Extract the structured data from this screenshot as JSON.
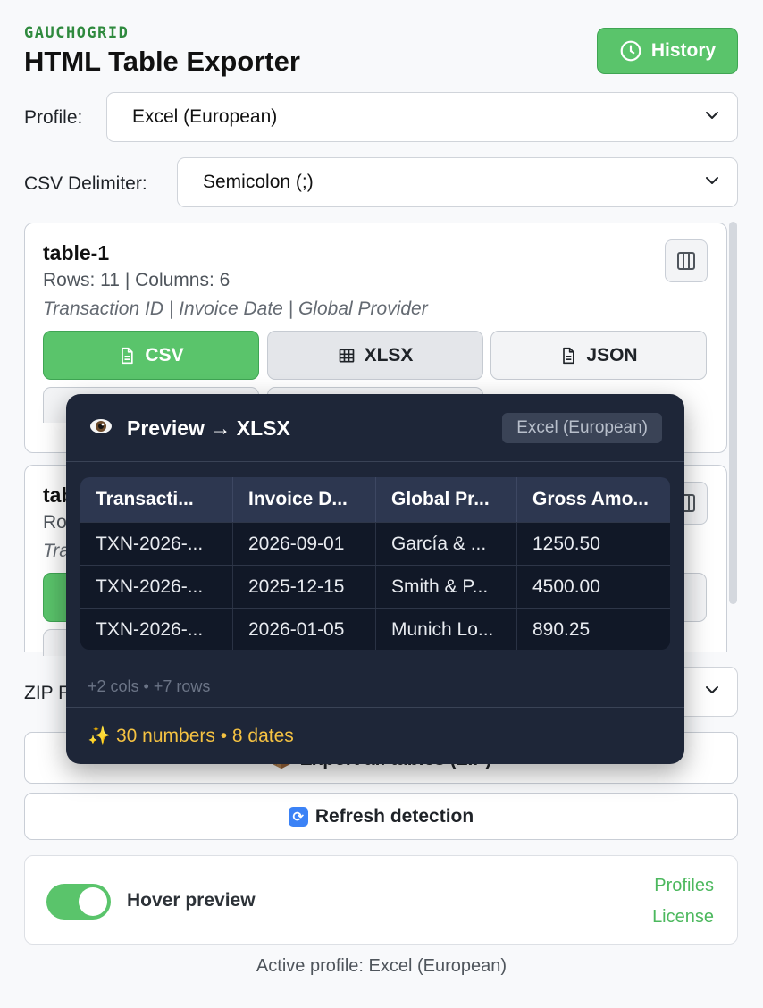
{
  "header": {
    "brand": "GAUCHOGRID",
    "title": "HTML Table Exporter",
    "history_label": "History"
  },
  "profile": {
    "label": "Profile:",
    "selected": "Excel (European)"
  },
  "csv_delimiter": {
    "label": "CSV Delimiter:",
    "selected": "Semicolon (;)"
  },
  "tables": [
    {
      "name": "table-1",
      "meta": "Rows: 11 | Columns: 6",
      "columns_preview": "Transaction ID | Invoice Date | Global Provider",
      "buttons": {
        "csv": "CSV",
        "xlsx": "XLSX",
        "json": "JSON"
      }
    },
    {
      "name": "tab",
      "meta": "Ro",
      "columns_preview": "Tra"
    }
  ],
  "zip": {
    "label": "ZIP F"
  },
  "actions": {
    "export_all": "Export all tables (ZIP)",
    "refresh": "Refresh detection"
  },
  "settings": {
    "hover_preview_label": "Hover preview",
    "hover_preview_enabled": true,
    "profiles_link": "Profiles",
    "license_link": "License"
  },
  "status": {
    "active_profile": "Active profile: Excel (European)"
  },
  "preview": {
    "title": "Preview → XLSX",
    "profile_badge": "Excel (European)",
    "headers": [
      "Transacti...",
      "Invoice D...",
      "Global Pr...",
      "Gross Amo..."
    ],
    "rows": [
      [
        "TXN-2026-...",
        "2026-09-01",
        "García & ...",
        "1250.50"
      ],
      [
        "TXN-2026-...",
        "2025-12-15",
        "Smith & P...",
        "4500.00"
      ],
      [
        "TXN-2026-...",
        "2026-01-05",
        "Munich Lo...",
        "890.25"
      ]
    ],
    "more": "+2 cols • +7 rows",
    "stats": "✨ 30 numbers • 8 dates"
  },
  "colors": {
    "accent": "#5ac46b",
    "brand": "#2f8a3e",
    "preview_bg": "#1e2638",
    "stats": "#f5c242"
  }
}
